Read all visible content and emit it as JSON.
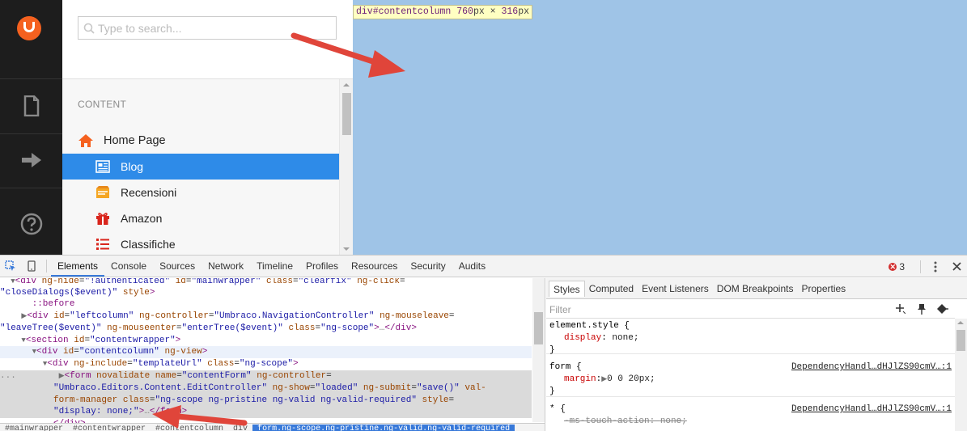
{
  "colors": {
    "accent": "#f5611f",
    "selection": "#2e8be8",
    "highlight": "#9fc4e7",
    "arrow": "#e0453a"
  },
  "search": {
    "placeholder": "Type to search..."
  },
  "tree": {
    "section_label": "CONTENT",
    "root": {
      "label": "Home Page",
      "icon": "home-icon"
    },
    "children": [
      {
        "label": "Blog",
        "icon": "blog-icon",
        "selected": true
      },
      {
        "label": "Recensioni",
        "icon": "recensioni-icon"
      },
      {
        "label": "Amazon",
        "icon": "gift-icon"
      },
      {
        "label": "Classifiche",
        "icon": "list-icon"
      }
    ]
  },
  "tooltip": {
    "element": "div#contentcolumn",
    "width": "760",
    "px1": "px",
    "times": " × ",
    "height": "316",
    "px2": "px"
  },
  "devtools": {
    "tabs": [
      "Elements",
      "Console",
      "Sources",
      "Network",
      "Timeline",
      "Profiles",
      "Resources",
      "Security",
      "Audits"
    ],
    "error_count": "3",
    "dom": {
      "l1": {
        "tag_open": "<div ",
        "a1": "ng-hide",
        "v1": "\"!authenticated\"",
        "a2": "id",
        "v2": "\"mainwrapper\"",
        "a3": "class",
        "v3": "\"clearfix\"",
        "a4": "ng-click"
      },
      "l2": {
        "v1": "\"closeDialogs($event)\"",
        "a1": "style",
        "close": ">"
      },
      "l3": {
        "text": "::before"
      },
      "l4": {
        "tag_open": "<div ",
        "a1": "id",
        "v1": "\"leftcolumn\"",
        "a2": "ng-controller",
        "v2": "\"Umbraco.NavigationController\"",
        "a3": "ng-mouseleave"
      },
      "l5": {
        "v1": "\"leaveTree($event)\"",
        "a1": "ng-mouseenter",
        "v2": "\"enterTree($event)\"",
        "a2": "class",
        "v3": "\"ng-scope\"",
        "gt": ">",
        "ell": "…",
        "close": "</div>"
      },
      "l6": {
        "tag_open": "<section ",
        "a1": "id",
        "v1": "\"contentwrapper\"",
        "close": ">"
      },
      "l7": {
        "tag_open": "<div ",
        "a1": "id",
        "v1": "\"contentcolumn\"",
        "a2": "ng-view",
        "close": ">"
      },
      "l8": {
        "tag_open": "<div ",
        "a1": "ng-include",
        "v1": "\"templateUrl\"",
        "a2": "class",
        "v2": "\"ng-scope\"",
        "close": ">"
      },
      "l9": {
        "dots": "...",
        "tag_open": "<form ",
        "a1": "novalidate",
        "a2": "name",
        "v2": "\"contentForm\"",
        "a3": "ng-controller"
      },
      "l10": {
        "v1": "\"Umbraco.Editors.Content.EditController\"",
        "a1": "ng-show",
        "v2": "\"loaded\"",
        "a2": "ng-submit",
        "v3": "\"save()\"",
        "a3": "val-"
      },
      "l11": {
        "a1": "form-manager",
        "a2": "class",
        "v1": "\"ng-scope ng-pristine ng-valid ng-valid-required\"",
        "a3": "style"
      },
      "l12": {
        "v1": "\"display: none;\"",
        "gt": ">",
        "ell": "…",
        "close": "</form>"
      },
      "l13": {
        "close": "</div>"
      }
    },
    "breadcrumbs": [
      "#mainwrapper",
      "#contentwrapper",
      "#contentcolumn",
      "div",
      "form.ng-scope.ng-pristine.ng-valid.ng-valid-required"
    ],
    "styles_tabs": [
      "Styles",
      "Computed",
      "Event Listeners",
      "DOM Breakpoints",
      "Properties"
    ],
    "filter_placeholder": "Filter",
    "rules": {
      "r1": {
        "selector": "element.style {",
        "prop": "display",
        "value": "none;",
        "close": "}"
      },
      "r2": {
        "selector": "form {",
        "source": "DependencyHandl…dHJlZS90cmV…:1",
        "prop": "margin",
        "tri": "▶",
        "value": "0 0 20px;",
        "close": "}"
      },
      "r3": {
        "selector": "* {",
        "source": "DependencyHandl…dHJlZS90cmV…:1",
        "prop": "-ms-touch-action",
        "value": "none;"
      }
    }
  }
}
